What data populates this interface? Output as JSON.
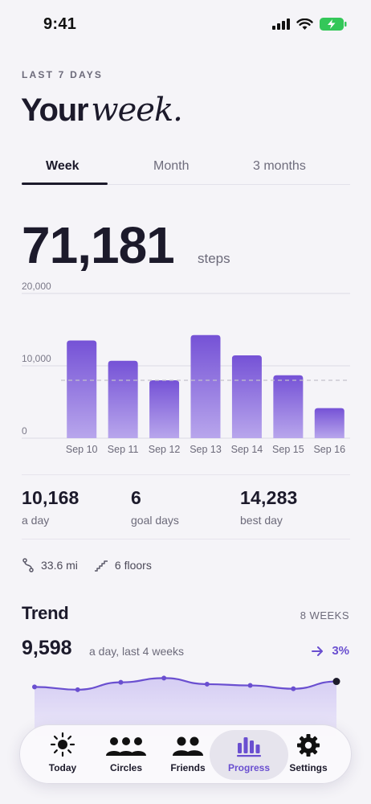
{
  "status": {
    "time": "9:41"
  },
  "header": {
    "eyebrow": "LAST 7 DAYS",
    "title_main": "Your",
    "title_accent": "week."
  },
  "tabs": [
    {
      "label": "Week",
      "active": true
    },
    {
      "label": "Month",
      "active": false
    },
    {
      "label": "3 months",
      "active": false
    }
  ],
  "summary": {
    "total": "71,181",
    "unit": "steps"
  },
  "chart_data": {
    "type": "bar",
    "categories": [
      "Sep 10",
      "Sep 11",
      "Sep 12",
      "Sep 13",
      "Sep 14",
      "Sep 15",
      "Sep 16"
    ],
    "values": [
      13500,
      10700,
      8000,
      14250,
      11450,
      8700,
      4150
    ],
    "yticks": [
      "20,000",
      "10,000",
      "0"
    ],
    "ytick_values": [
      20000,
      10000,
      0
    ],
    "ylim": [
      0,
      20000
    ],
    "average_line": 8000,
    "grid": true,
    "colors": {
      "bar_top": "#7552d6",
      "bar_bottom": "#b8a6ec",
      "avg_line": "#c3c0cc"
    }
  },
  "stats": [
    {
      "value": "10,168",
      "label": "a day"
    },
    {
      "value": "6",
      "label": "goal days"
    },
    {
      "value": "14,283",
      "label": "best day"
    }
  ],
  "extras": {
    "distance": "33.6 mi",
    "floors": "6 floors"
  },
  "trend": {
    "title": "Trend",
    "range": "8 WEEKS",
    "value": "9,598",
    "caption": "a day, last 4 weeks",
    "change": "3%",
    "series": [
      9300,
      9150,
      9550,
      9780,
      9450,
      9380,
      9200,
      9598
    ],
    "ylim": [
      6000,
      10800
    ],
    "colors": {
      "line": "#6a4fd0",
      "last_point": "#1c1a2b",
      "fill_top": "#d5cdf3",
      "fill_bottom": "#f1eefb"
    }
  },
  "tabbar": [
    {
      "label": "Today",
      "icon": "sun-icon",
      "active": false
    },
    {
      "label": "Circles",
      "icon": "group-icon",
      "active": false
    },
    {
      "label": "Friends",
      "icon": "friends-icon",
      "active": false
    },
    {
      "label": "Progress",
      "icon": "bar-chart-icon",
      "active": true
    },
    {
      "label": "Settings",
      "icon": "gear-icon",
      "active": false
    }
  ],
  "colors": {
    "accent": "#6a4fd0",
    "background": "#f5f4f8",
    "text": "#1c1a2b",
    "muted": "#6c6a7a"
  }
}
